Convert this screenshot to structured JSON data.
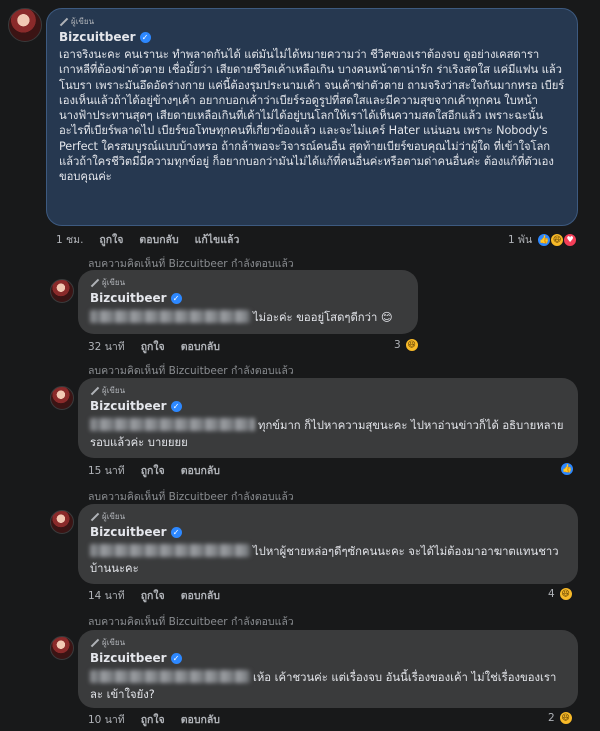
{
  "author": {
    "name": "Bizcuitbeer",
    "badge": "ผู้เขียน"
  },
  "main_comment": {
    "text": "เอาจริงนะคะ คนเรานะ ทำพลาดกันได้ แต่มันไม่ได้หมายความว่า ชีวิตของเราต้องจบ ดูอย่างเคสดาราเกาหลีที่ต้องฆ่าตัวตาย เชื่อมั้ยว่า เสียดายชีวิตเค้าเหลือเกิน บางคนหน้าตาน่ารัก ร่าเริงสดใส แค่มีแฟน แล้วโนบรา เพราะมันอึดอัดร่างกาย แค่นี้ต้องรุมประนามเค้า จนเค้าฆ่าตัวตาย ถามจริงว่าสะใจกันมากหรอ เบียร์เองเห็นแล้วถ้าได้อยู่ข้างๆเค้า อยากบอกเค้าว่าเบียร์รอดูรูปที่สดใสและมีความสุขจากเค้าทุกคน ใบหน้านางฟ้าประทานสุดๆ เสียดายเหลือเกินที่เค้าไม่ได้อยู่บนโลกให้เราได้เห็นความสดใสอีกแล้ว เพราะฉะนั้น อะไรที่เบียร์พลาดไป เบียร์ขอโทษทุกคนที่เกี่ยวข้องแล้ว และจะไม่แคร์ Hater แน่นอน เพราะ Nobody's Perfect ใครสมบูรณ์แบบบ้างหรอ ถ้ากล้าพอจะวิจารณ์คนอื่น สุดท้ายเบียร์ขอบคุณไม่ว่าผู้ใด ที่เข้าใจโลก แล้วถ้าใครชีวิตมีมีความทุกข์อยู่ ก็อยากบอกว่ามันไม่ได้แก้ที่คนอื่นค่ะหรือตามด่าคนอื่นค่ะ ต้องแก้ที่ตัวเอง ขอบคุณค่ะ",
    "time": "1 ชม.",
    "like": "ถูกใจ",
    "reply": "ตอบกลับ",
    "edit": "แก้ไขแล้ว",
    "reaction_count": "1 พัน",
    "reactions": [
      "like",
      "haha",
      "love"
    ]
  },
  "reply_author_note": "ลบความคิดเห็นที่ Bizcuitbeer กำลังตอบแล้ว",
  "replies": [
    {
      "text": "ไม่อะค่ะ ขออยู่โสดๆดีกว่า 😊",
      "time": "32 นาที",
      "like": "ถูกใจ",
      "reply": "ตอบกลับ",
      "reaction_count": "3",
      "reactions": [
        "haha"
      ]
    },
    {
      "text": "ทุกข์มาก ก็ไปหาความสุขนะคะ ไปหาอ่านข่าวก็ได้ อธิบายหลายรอบแล้วค่ะ บายยยย",
      "time": "15 นาที",
      "like": "ถูกใจ",
      "reply": "ตอบกลับ",
      "reaction_count": "",
      "reactions": [
        "like"
      ]
    },
    {
      "text": "ไปหาผู้ชายหล่อๆดีๆซักคนนะคะ จะได้ไม่ต้องมาอาฆาตแทนชาวบ้านนะคะ",
      "time": "14 นาที",
      "like": "ถูกใจ",
      "reply": "ตอบกลับ",
      "reaction_count": "4",
      "reactions": [
        "haha"
      ]
    },
    {
      "text": "เห้อ เค้าชวนค่ะ แต่เรื่องจบ อันนี้เรื่องของเค้า ไม่ใช่เรื่องของเราละ เข้าใจยัง?",
      "time": "10 นาที",
      "like": "ถูกใจ",
      "reply": "ตอบกลับ",
      "reaction_count": "2",
      "reactions": [
        "haha"
      ]
    }
  ],
  "colors": {
    "background": "#18191a",
    "bubble": "#3a3b3c",
    "main_bubble": "#263850",
    "text": "#e4e6eb",
    "secondary": "#b0b3b8"
  }
}
